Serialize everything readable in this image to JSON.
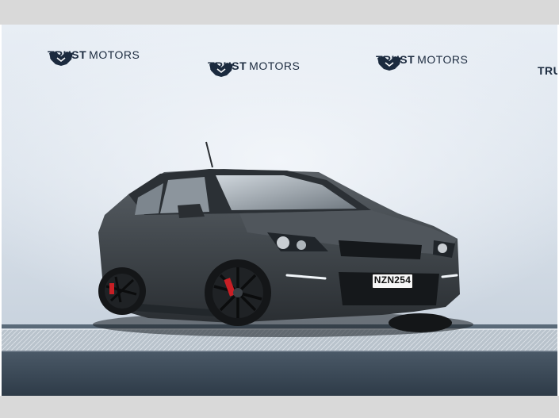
{
  "logos": [
    {
      "word1": "TRUST",
      "word2": "MOTORS"
    },
    {
      "word1": "TRUST",
      "word2": "MOTORS"
    },
    {
      "word1": "TRUST",
      "word2": "MOTORS"
    },
    {
      "word1": "TRU",
      "word2": ""
    }
  ],
  "car": {
    "plate": "NZN254",
    "color": "#3f4449",
    "brake_color": "#c81f25"
  },
  "colors": {
    "wall": "#dfe7f0",
    "floor": "#3a4a5a",
    "brand_text": "#1b2a3e",
    "frame_bars": "#d9d9d9"
  }
}
